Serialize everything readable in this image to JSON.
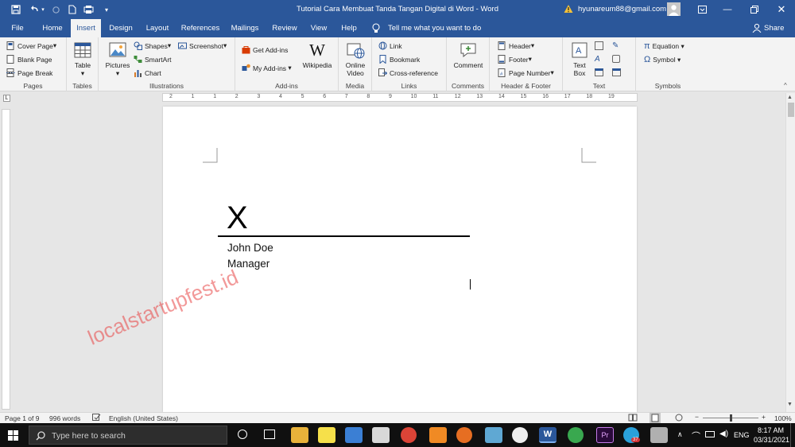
{
  "window": {
    "title": "Tutorial Cara Membuat Tanda Tangan Digital di Word  -  Word",
    "account": "hyunareum88@gmail.com",
    "accent": "#2b579a"
  },
  "tabs": [
    "File",
    "Home",
    "Insert",
    "Design",
    "Layout",
    "References",
    "Mailings",
    "Review",
    "View",
    "Help"
  ],
  "active_tab": "Insert",
  "tell_me": "Tell me what you want to do",
  "share": "Share",
  "ribbon": {
    "pages": {
      "items": [
        "Cover Page",
        "Blank Page",
        "Page Break"
      ],
      "label": "Pages"
    },
    "tables": {
      "table": "Table",
      "label": "Tables"
    },
    "illustrations": {
      "pictures": "Pictures",
      "shapes": "Shapes",
      "smartart": "SmartArt",
      "chart": "Chart",
      "screenshot": "Screenshot",
      "label": "Illustrations"
    },
    "addins": {
      "get": "Get Add-ins",
      "my": "My Add-ins",
      "wikipedia": "Wikipedia",
      "label": "Add-ins"
    },
    "media": {
      "online_video": "Online Video",
      "label": "Media"
    },
    "links": {
      "link": "Link",
      "bookmark": "Bookmark",
      "crossref": "Cross-reference",
      "label": "Links"
    },
    "comments": {
      "comment": "Comment",
      "label": "Comments"
    },
    "headerfooter": {
      "header": "Header",
      "footer": "Footer",
      "page_number": "Page Number",
      "label": "Header & Footer"
    },
    "text": {
      "textbox": "Text Box",
      "label": "Text"
    },
    "symbols": {
      "equation": "Equation",
      "symbol": "Symbol",
      "label": "Symbols"
    }
  },
  "ruler_numbers": [
    "2",
    "1",
    "1",
    "2",
    "3",
    "4",
    "5",
    "6",
    "7",
    "8",
    "9",
    "10",
    "11",
    "12",
    "13",
    "14",
    "15",
    "16",
    "17",
    "18",
    "19"
  ],
  "document": {
    "signature_mark": "X",
    "name": "John Doe",
    "role": "Manager",
    "watermark": "localstartupfest.id"
  },
  "status": {
    "page": "Page 1 of 9",
    "words": "996 words",
    "language": "English (United States)",
    "zoom": "100%",
    "zoom_level": 1.0
  },
  "taskbar": {
    "search_placeholder": "Type here to search",
    "lang": "ENG",
    "time": "8:17 AM",
    "date": "03/31/2021",
    "badge": "37"
  }
}
